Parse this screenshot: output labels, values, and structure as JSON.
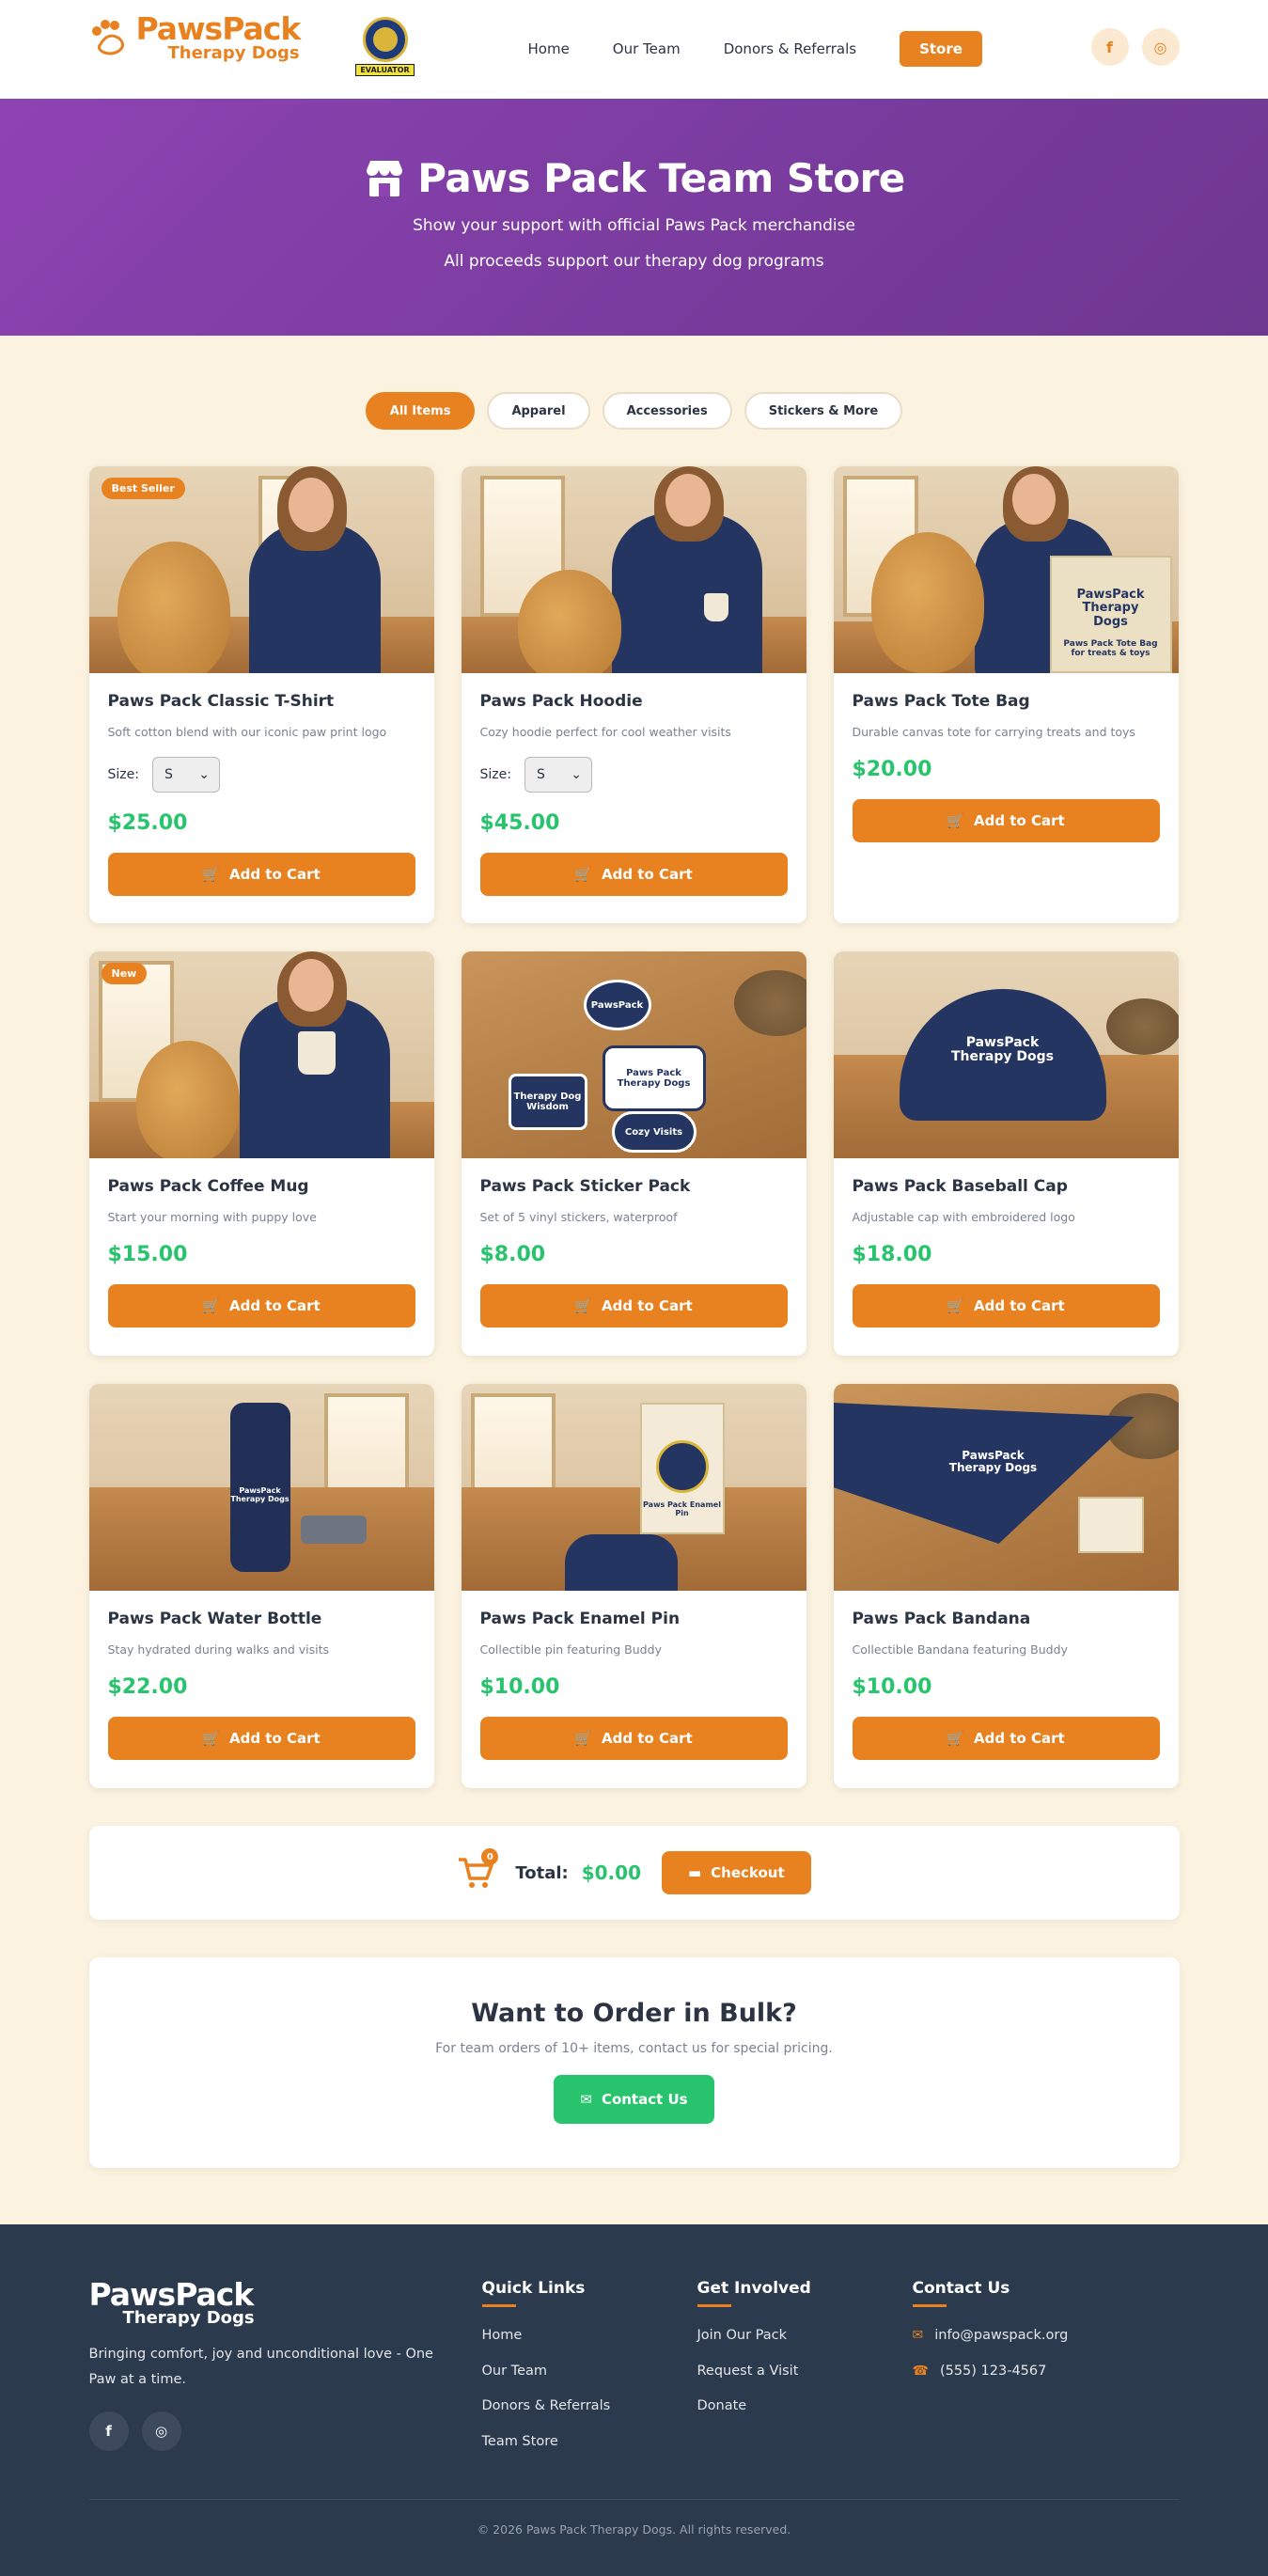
{
  "header": {
    "logo_line1": "PawsPack",
    "logo_line2": "Therapy Dogs",
    "badge_label": "EVALUATOR",
    "nav": [
      "Home",
      "Our Team",
      "Donors & Referrals",
      "Store"
    ],
    "social": [
      "f",
      "◎"
    ]
  },
  "hero": {
    "title": "Paws Pack Team Store",
    "line1": "Show your support with official Paws Pack merchandise",
    "line2": "All proceeds support our therapy dog programs"
  },
  "filters": [
    "All Items",
    "Apparel",
    "Accessories",
    "Stickers & More"
  ],
  "products": [
    {
      "name": "Paws Pack Classic T-Shirt",
      "desc": "Soft cotton blend with our iconic paw print logo",
      "price": "$25.00",
      "ribbon": "Best Seller",
      "size_label": "Size:",
      "size_value": "S",
      "cta": "Add to Cart"
    },
    {
      "name": "Paws Pack Hoodie",
      "desc": "Cozy hoodie perfect for cool weather visits",
      "price": "$45.00",
      "size_label": "Size:",
      "size_value": "S",
      "cta": "Add to Cart"
    },
    {
      "name": "Paws Pack Tote Bag",
      "desc": "Durable canvas tote for carrying treats and toys",
      "price": "$20.00",
      "cta": "Add to Cart",
      "image_text": "PawsPack Therapy Dogs",
      "image_caption": "Paws Pack Tote Bag for treats & toys"
    },
    {
      "name": "Paws Pack Coffee Mug",
      "desc": "Start your morning with puppy love",
      "price": "$15.00",
      "ribbon": "New",
      "cta": "Add to Cart"
    },
    {
      "name": "Paws Pack Sticker Pack",
      "desc": "Set of 5 vinyl stickers, waterproof",
      "price": "$8.00",
      "cta": "Add to Cart",
      "stickers": [
        "PawsPack",
        "Paws Pack Therapy Dogs",
        "Therapy Dog Wisdom",
        "Cozy Visits"
      ]
    },
    {
      "name": "Paws Pack Baseball Cap",
      "desc": "Adjustable cap with embroidered logo",
      "price": "$18.00",
      "cta": "Add to Cart",
      "image_text": "PawsPack Therapy Dogs"
    },
    {
      "name": "Paws Pack Water Bottle",
      "desc": "Stay hydrated during walks and visits",
      "price": "$22.00",
      "cta": "Add to Cart",
      "image_text": "PawsPack Therapy Dogs"
    },
    {
      "name": "Paws Pack Enamel Pin",
      "desc": "Collectible pin featuring Buddy",
      "price": "$10.00",
      "cta": "Add to Cart",
      "image_text": "Paws Pack Enamel Pin"
    },
    {
      "name": "Paws Pack Bandana",
      "desc": "Collectible Bandana featuring Buddy",
      "price": "$10.00",
      "cta": "Add to Cart",
      "image_text": "PawsPack Therapy Dogs"
    }
  ],
  "cart": {
    "count": "0",
    "total_label": "Total:",
    "total_value": "$0.00",
    "checkout": "Checkout"
  },
  "bulk": {
    "title": "Want to Order in Bulk?",
    "text": "For team orders of 10+ items, contact us for special pricing.",
    "cta": "Contact Us"
  },
  "footer": {
    "logo_line1": "PawsPack",
    "logo_line2": "Therapy Dogs",
    "tagline": "Bringing comfort, joy and unconditional love - One Paw at a time.",
    "social": [
      "f",
      "◎"
    ],
    "quick_links_title": "Quick Links",
    "quick_links": [
      "Home",
      "Our Team",
      "Donors & Referrals",
      "Team Store"
    ],
    "get_involved_title": "Get Involved",
    "get_involved": [
      "Join Our Pack",
      "Request a Visit",
      "Donate"
    ],
    "contact_title": "Contact Us",
    "email": "info@pawspack.org",
    "phone": "(555) 123-4567",
    "copyright": "© 2026 Paws Pack Therapy Dogs. All rights reserved."
  },
  "colors": {
    "accent": "#e8811f",
    "price": "#27c46d",
    "hero_purple": "#8e43b3",
    "footer_bg": "#2c3a4e",
    "page_bg": "#fbf2df"
  }
}
